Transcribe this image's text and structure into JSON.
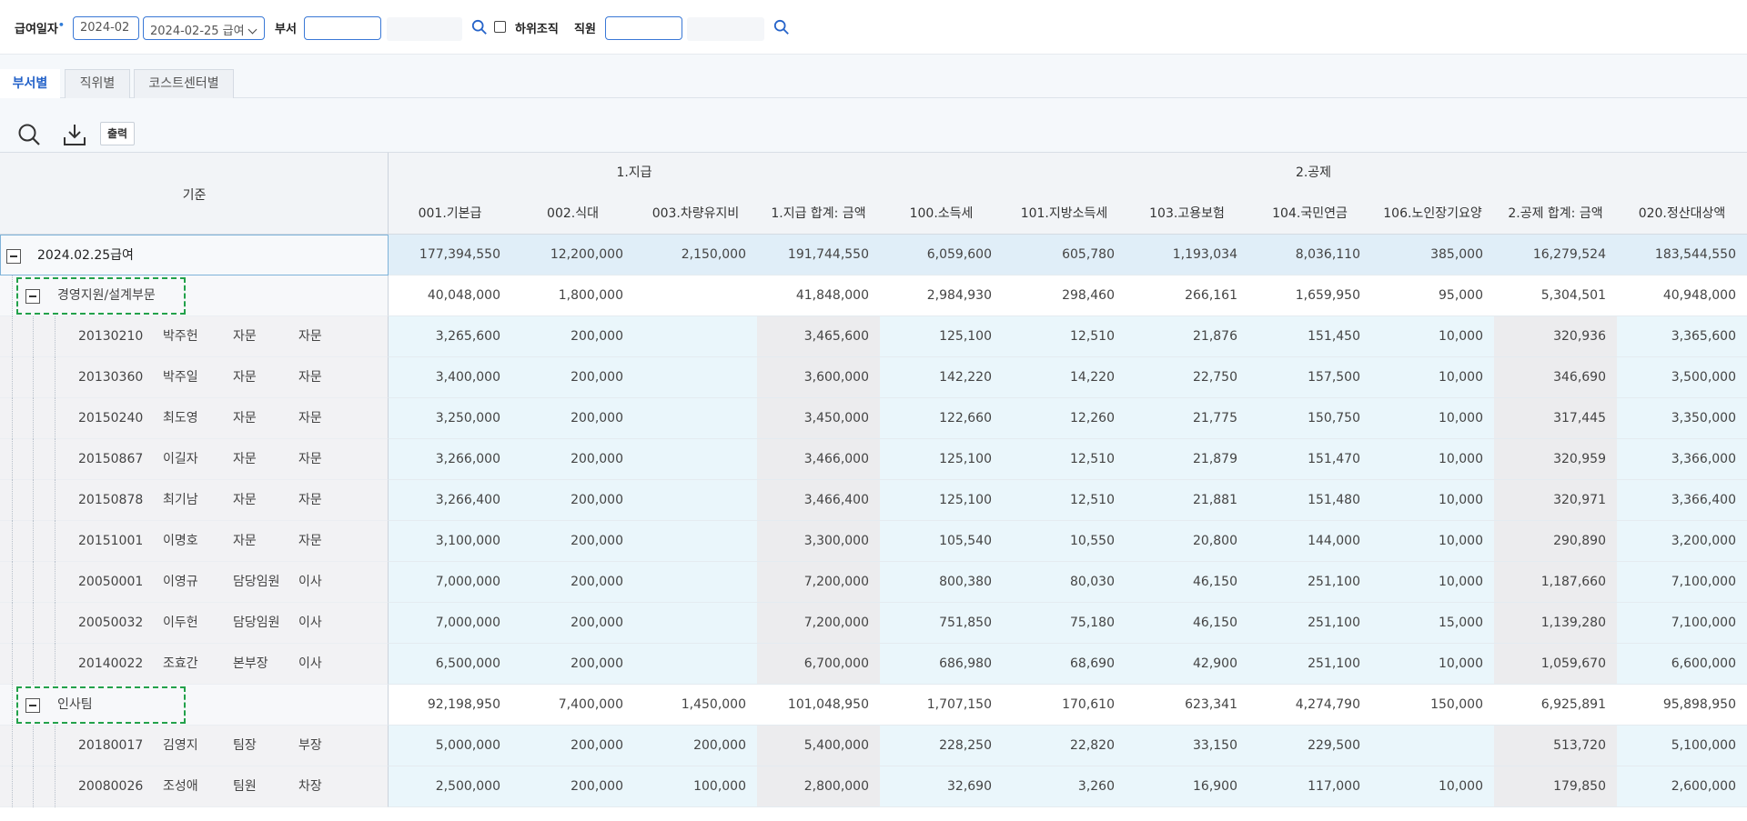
{
  "filter": {
    "pay_date_label": "급여일자",
    "required_mark": "•",
    "pay_month": "2024-02",
    "pay_run": "2024-02-25 급여",
    "dept_label": "부서",
    "dept_value": "",
    "sub_org_label": "하위조직",
    "employee_label": "직원",
    "employee_value": ""
  },
  "tabs": [
    {
      "label": "부서별",
      "active": true
    },
    {
      "label": "직위별",
      "active": false
    },
    {
      "label": "코스트센터별",
      "active": false
    }
  ],
  "toolbar": {
    "print_label": "출력"
  },
  "grid": {
    "basis_header": "기준",
    "groups": [
      {
        "label": "1.지급"
      },
      {
        "label": "2.공제"
      }
    ],
    "columns": [
      "001.기본급",
      "002.식대",
      "003.차량유지비",
      "1.지급 합계: 금액",
      "100.소득세",
      "101.지방소득세",
      "103.고용보험",
      "104.국민연금",
      "106.노인장기요양",
      "2.공제 합계: 금액",
      "020.정산대상액"
    ],
    "rows": [
      {
        "type": "root",
        "label": "2024.02.25급여",
        "values": [
          "177,394,550",
          "12,200,000",
          "2,150,000",
          "191,744,550",
          "6,059,600",
          "605,780",
          "1,193,034",
          "8,036,110",
          "385,000",
          "16,279,524",
          "183,544,550"
        ]
      },
      {
        "type": "dept",
        "label": "경영지원/설계부문",
        "values": [
          "40,048,000",
          "1,800,000",
          "",
          "41,848,000",
          "2,984,930",
          "298,460",
          "266,161",
          "1,659,950",
          "95,000",
          "5,304,501",
          "40,948,000"
        ]
      },
      {
        "type": "emp",
        "id": "20130210",
        "name": "박주헌",
        "title": "자문",
        "grade": "자문",
        "values": [
          "3,265,600",
          "200,000",
          "",
          "3,465,600",
          "125,100",
          "12,510",
          "21,876",
          "151,450",
          "10,000",
          "320,936",
          "3,365,600"
        ]
      },
      {
        "type": "emp",
        "id": "20130360",
        "name": "박주일",
        "title": "자문",
        "grade": "자문",
        "values": [
          "3,400,000",
          "200,000",
          "",
          "3,600,000",
          "142,220",
          "14,220",
          "22,750",
          "157,500",
          "10,000",
          "346,690",
          "3,500,000"
        ]
      },
      {
        "type": "emp",
        "id": "20150240",
        "name": "최도영",
        "title": "자문",
        "grade": "자문",
        "values": [
          "3,250,000",
          "200,000",
          "",
          "3,450,000",
          "122,660",
          "12,260",
          "21,775",
          "150,750",
          "10,000",
          "317,445",
          "3,350,000"
        ]
      },
      {
        "type": "emp",
        "id": "20150867",
        "name": "이길자",
        "title": "자문",
        "grade": "자문",
        "values": [
          "3,266,000",
          "200,000",
          "",
          "3,466,000",
          "125,100",
          "12,510",
          "21,879",
          "151,470",
          "10,000",
          "320,959",
          "3,366,000"
        ]
      },
      {
        "type": "emp",
        "id": "20150878",
        "name": "최기남",
        "title": "자문",
        "grade": "자문",
        "values": [
          "3,266,400",
          "200,000",
          "",
          "3,466,400",
          "125,100",
          "12,510",
          "21,881",
          "151,480",
          "10,000",
          "320,971",
          "3,366,400"
        ]
      },
      {
        "type": "emp",
        "id": "20151001",
        "name": "이명호",
        "title": "자문",
        "grade": "자문",
        "values": [
          "3,100,000",
          "200,000",
          "",
          "3,300,000",
          "105,540",
          "10,550",
          "20,800",
          "144,000",
          "10,000",
          "290,890",
          "3,200,000"
        ]
      },
      {
        "type": "emp",
        "id": "20050001",
        "name": "이영규",
        "title": "담당임원",
        "grade": "이사",
        "values": [
          "7,000,000",
          "200,000",
          "",
          "7,200,000",
          "800,380",
          "80,030",
          "46,150",
          "251,100",
          "10,000",
          "1,187,660",
          "7,100,000"
        ]
      },
      {
        "type": "emp",
        "id": "20050032",
        "name": "이두헌",
        "title": "담당임원",
        "grade": "이사",
        "values": [
          "7,000,000",
          "200,000",
          "",
          "7,200,000",
          "751,850",
          "75,180",
          "46,150",
          "251,100",
          "15,000",
          "1,139,280",
          "7,100,000"
        ]
      },
      {
        "type": "emp",
        "id": "20140022",
        "name": "조효간",
        "title": "본부장",
        "grade": "이사",
        "values": [
          "6,500,000",
          "200,000",
          "",
          "6,700,000",
          "686,980",
          "68,690",
          "42,900",
          "251,100",
          "10,000",
          "1,059,670",
          "6,600,000"
        ]
      },
      {
        "type": "dept",
        "label": "인사팀",
        "values": [
          "92,198,950",
          "7,400,000",
          "1,450,000",
          "101,048,950",
          "1,707,150",
          "170,610",
          "623,341",
          "4,274,790",
          "150,000",
          "6,925,891",
          "95,898,950"
        ]
      },
      {
        "type": "emp",
        "id": "20180017",
        "name": "김영지",
        "title": "팀장",
        "grade": "부장",
        "values": [
          "5,000,000",
          "200,000",
          "200,000",
          "5,400,000",
          "228,250",
          "22,820",
          "33,150",
          "229,500",
          "",
          "513,720",
          "5,100,000"
        ]
      },
      {
        "type": "emp",
        "id": "20080026",
        "name": "조성애",
        "title": "팀원",
        "grade": "차장",
        "values": [
          "2,500,000",
          "200,000",
          "100,000",
          "2,800,000",
          "32,690",
          "3,260",
          "16,900",
          "117,000",
          "10,000",
          "179,850",
          "2,600,000"
        ]
      }
    ]
  },
  "colors": {
    "accent": "#2563c9",
    "input_border": "#3a78d6",
    "highlight_green": "#22a14a",
    "row_blue": "#eaf6fb",
    "subtotal_gray": "#ececee"
  }
}
